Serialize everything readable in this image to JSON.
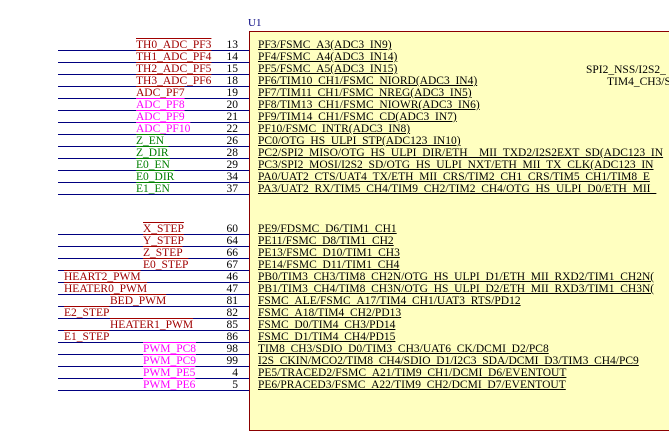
{
  "component": {
    "ref": "U1",
    "body_fill": "#ffffc0",
    "body_border": "#8b0000",
    "wire_color": "#000080"
  },
  "colors": {
    "dark_red": "#a00000",
    "magenta": "#ff00ff",
    "green": "#008000"
  },
  "pins": [
    {
      "net": "TH0_ADC_PF3",
      "num": "13",
      "func": "PF3/FSMC_A3(ADC3_IN9)",
      "color": "dark_red"
    },
    {
      "net": "TH1_ADC_PF4",
      "num": "14",
      "func": "PF4/FSMC_A4(ADC3_IN14)",
      "color": "dark_red"
    },
    {
      "net": "TH2_ADC_PF5",
      "num": "15",
      "func": "PF5/FSMC_A5(ADC3_IN15)",
      "color": "dark_red"
    },
    {
      "net": "TH3_ADC_PF6",
      "num": "18",
      "func": "PF6/TIM10_CH1/FSMC_NIORD(ADC3_IN4)",
      "color": "dark_red"
    },
    {
      "net": "ADC_PF7",
      "num": "19",
      "func": "PF7/TIM11_CH1/FSMC_NREG(ADC3_IN5)",
      "color": "dark_red"
    },
    {
      "net": "ADC_PF8",
      "num": "20",
      "func": "PF8/TIM13_CH1/FSMC_NIOWR(ADC3_IN6)",
      "color": "magenta"
    },
    {
      "net": "ADC_PF9",
      "num": "21",
      "func": "PF9/TIM14_CH1/FSMC_CD(ADC3_IN7)",
      "color": "magenta"
    },
    {
      "net": "ADC_PF10",
      "num": "22",
      "func": "PF10/FSMC_INTR(ADC3_IN8)",
      "color": "magenta"
    },
    {
      "net": "Z_EN",
      "num": "26",
      "func": "PC0/OTG_HS_ULPI_STP(ADC123_IN10)",
      "color": "green"
    },
    {
      "net": "Z_DIR",
      "num": "28",
      "func": "PC2/SPI2_MISO/OTG_HS_ULPI_DIR/ETH__MII_TXD2/I2S2EXT_SD(ADC123_IN",
      "color": "green"
    },
    {
      "net": "E0_EN",
      "num": "29",
      "func": "PC3/SPI2_MOSI/I2S2_SD/OTG_HS_ULPI_NXT/ETH_MII_TX_CLK(ADC123_IN",
      "color": "green"
    },
    {
      "net": "E0_DIR",
      "num": "34",
      "func": "PA0/UAT2_CTS/UAT4_TX/ETH_MII_CRS/TIM2_CH1_CRS/TIM5_CH1/TIM8_E",
      "color": "green"
    },
    {
      "net": "E1_EN",
      "num": "37",
      "func": "PA3/UAT2_RX/TIM5_CH4/TIM9_CH2/TIM2_CH4/OTG_HS_ULPI_D0/ETH_MII_",
      "color": "green"
    },
    {
      "net": "X_STEP",
      "num": "60",
      "func": "PE9/FDSMC_D6/TIM1_CH1",
      "color": "dark_red"
    },
    {
      "net": "Y_STEP",
      "num": "64",
      "func": "PE11/FSMC_D8/TIM1_CH2",
      "color": "dark_red"
    },
    {
      "net": "Z_STEP",
      "num": "66",
      "func": "PE13/FSMC_D10/TIM1_CH3",
      "color": "dark_red"
    },
    {
      "net": "E0_STEP",
      "num": "67",
      "func": "PE14/FSMC_D11/TIM1_CH4",
      "color": "dark_red"
    },
    {
      "net": "HEART2_PWM",
      "num": "46",
      "func": "PB0/TIM3_CH3/TIM8_CH2N/OTG_HS_ULPI_D1/ETH_MII_RXD2/TIM1_CH2N(",
      "color": "dark_red"
    },
    {
      "net": "HEATER0_PWM",
      "num": "47",
      "func": "PB1/TIM3_CH4/TIM8_CH3N/OTG_HS_ULPI_D2/ETH_MII_RXD3/TIM1_CH3N(",
      "color": "dark_red"
    },
    {
      "net": "BED_PWM",
      "num": "81",
      "func": "FSMC_ALE/FSMC_A17/TIM4_CH1/UAT3_RTS/PD12",
      "color": "dark_red"
    },
    {
      "net": "E2_STEP",
      "num": "82",
      "func": "FSMC_A18/TIM4_CH2/PD13",
      "color": "dark_red"
    },
    {
      "net": "HEATER1_PWM",
      "num": "85",
      "func": "FSMC_D0/TIM4_CH3/PD14",
      "color": "dark_red"
    },
    {
      "net": "E1_STEP",
      "num": "86",
      "func": "FSMC_D1/TIM4_CH4/PD15",
      "color": "dark_red"
    },
    {
      "net": "PWM_PC8",
      "num": "98",
      "func": "TIM8_CH3/SDIO_D0/TIM3_CH3/UAT6_CK/DCMI_D2/PC8",
      "color": "magenta"
    },
    {
      "net": "PWM_PC9",
      "num": "99",
      "func": "I2S_CKIN/MCO2/TIM8_CH4/SDIO_D1/I2C3_SDA/DCMI_D3/TIM3_CH4/PC9",
      "color": "magenta"
    },
    {
      "net": "PWM_PE5",
      "num": "4",
      "func": "PE5/TRACED2/FSMC_A21/TIM9_CH1/DCMI_D6/EVENTOUT",
      "color": "magenta"
    },
    {
      "net": "PWM_PE6",
      "num": "5",
      "func": "PE6/PRACED3/FSMC_A22/TIM9_CH2/DCMI_D7/EVENTOUT",
      "color": "magenta"
    }
  ],
  "right_labels": [
    {
      "text": "SPI2_NSS/I2S2_"
    },
    {
      "text": "TIM4_CH3/S"
    }
  ]
}
